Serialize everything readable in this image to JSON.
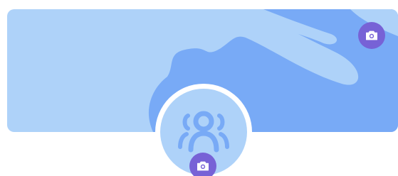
{
  "profile_header": {
    "cover": {
      "background_color": "#aed2f9",
      "shape_color": "#78aaf6",
      "edit_button_icon": "camera-icon",
      "edit_button_color": "#7762d6"
    },
    "avatar": {
      "placeholder_icon": "group-users-icon",
      "background_color": "#aed2f9",
      "icon_color": "#78aaf6",
      "edit_button_icon": "camera-icon",
      "edit_button_color": "#7762d6"
    }
  }
}
